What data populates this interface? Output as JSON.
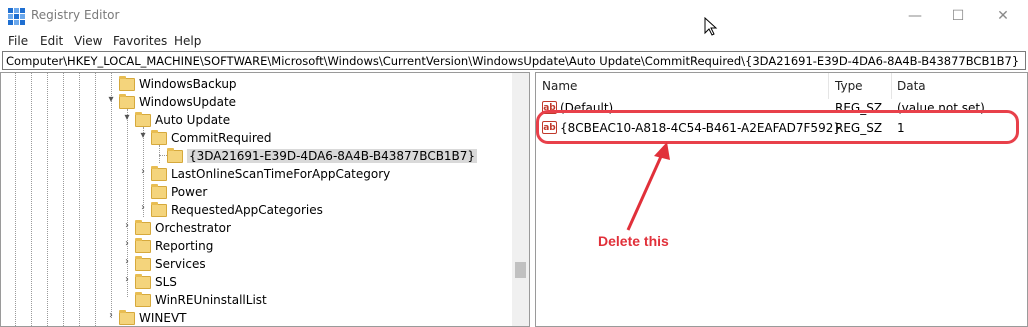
{
  "window": {
    "title": "Registry Editor",
    "controls": {
      "minimize": "—",
      "maximize": "☐",
      "close": "✕"
    }
  },
  "menu": [
    "File",
    "Edit",
    "View",
    "Favorites",
    "Help"
  ],
  "address": "Computer\\HKEY_LOCAL_MACHINE\\SOFTWARE\\Microsoft\\Windows\\CurrentVersion\\WindowsUpdate\\Auto Update\\CommitRequired\\{3DA21691-E39D-4DA6-8A4B-B43877BCB1B7}",
  "tree": {
    "items": [
      {
        "label": "WindowsBackup",
        "chevron": ""
      },
      {
        "label": "WindowsUpdate",
        "chevron": "▾"
      },
      {
        "label": "Auto Update",
        "chevron": "▾"
      },
      {
        "label": "CommitRequired",
        "chevron": "▾"
      },
      {
        "label": "{3DA21691-E39D-4DA6-8A4B-B43877BCB1B7}",
        "chevron": "",
        "selected": true
      },
      {
        "label": "LastOnlineScanTimeForAppCategory",
        "chevron": "›"
      },
      {
        "label": "Power",
        "chevron": ""
      },
      {
        "label": "RequestedAppCategories",
        "chevron": "›"
      },
      {
        "label": "Orchestrator",
        "chevron": "›"
      },
      {
        "label": "Reporting",
        "chevron": "›"
      },
      {
        "label": "Services",
        "chevron": "›"
      },
      {
        "label": "SLS",
        "chevron": "›"
      },
      {
        "label": "WinREUninstallList",
        "chevron": ""
      },
      {
        "label": "WINEVT",
        "chevron": "›"
      }
    ]
  },
  "values": {
    "columns": {
      "name": "Name",
      "type": "Type",
      "data": "Data"
    },
    "rows": [
      {
        "name": "(Default)",
        "type": "REG_SZ",
        "data": "(value not set)",
        "icon": "string-value-icon"
      },
      {
        "name": "{8CBEAC10-A818-4C54-B461-A2EAFAD7F592}",
        "type": "REG_SZ",
        "data": "1",
        "icon": "string-value-icon"
      }
    ]
  },
  "annotation": {
    "text": "Delete this",
    "color": "#e1303a"
  }
}
